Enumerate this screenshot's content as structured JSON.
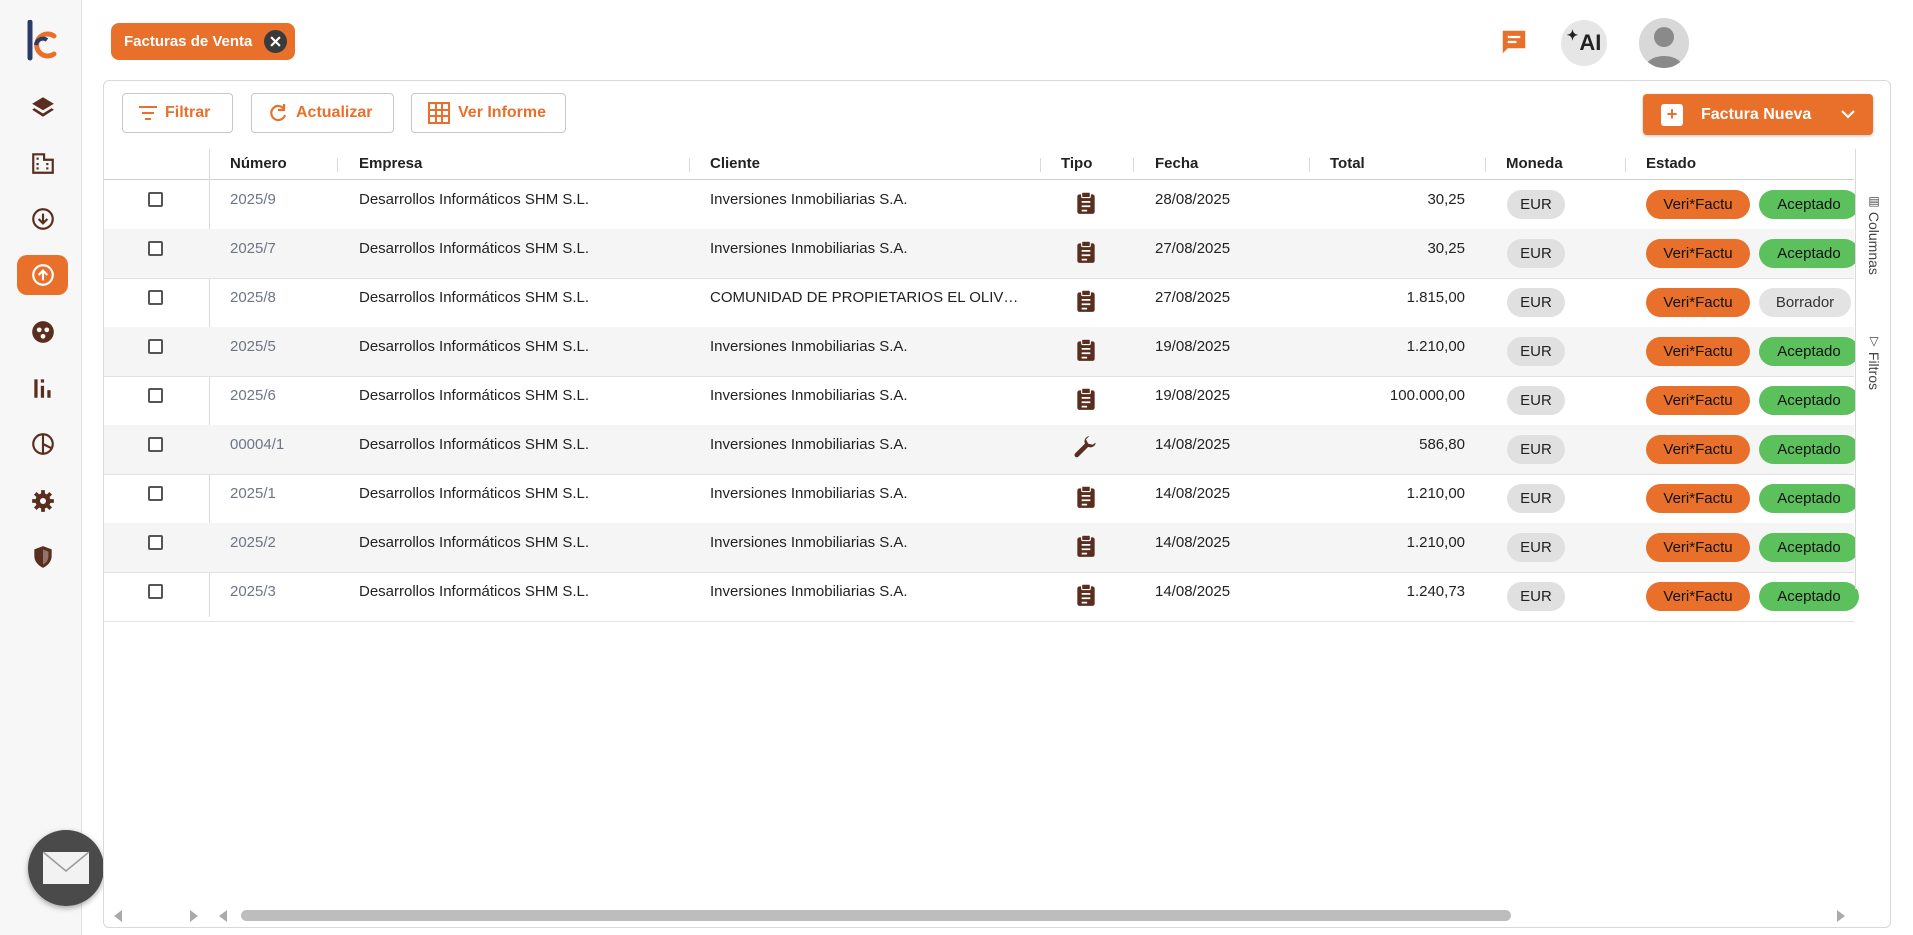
{
  "tabs": {
    "active_label": "Facturas de Venta"
  },
  "header": {
    "ai_label": "AI"
  },
  "toolbar": {
    "filter": "Filtrar",
    "refresh": "Actualizar",
    "report": "Ver Informe",
    "new_invoice": "Factura Nueva"
  },
  "columns": {
    "numero": "Número",
    "empresa": "Empresa",
    "cliente": "Cliente",
    "tipo": "Tipo",
    "fecha": "Fecha",
    "total": "Total",
    "moneda": "Moneda",
    "estado": "Estado"
  },
  "side_tabs": {
    "columns": "Columnas",
    "filters": "Filtros"
  },
  "colors": {
    "accent": "#e8702a",
    "accepted": "#5cc05c",
    "draft": "#e3e3e3"
  },
  "rows": [
    {
      "numero": "2025/9",
      "empresa": "Desarrollos Informáticos SHM S.L.",
      "cliente": "Inversiones Inmobiliarias S.A.",
      "tipo": "clipboard-icon",
      "fecha": "28/08/2025",
      "total": "30,25",
      "moneda": "EUR",
      "veri": "Veri*Factu",
      "estado": "Aceptado"
    },
    {
      "numero": "2025/7",
      "empresa": "Desarrollos Informáticos SHM S.L.",
      "cliente": "Inversiones Inmobiliarias S.A.",
      "tipo": "clipboard-icon",
      "fecha": "27/08/2025",
      "total": "30,25",
      "moneda": "EUR",
      "veri": "Veri*Factu",
      "estado": "Aceptado"
    },
    {
      "numero": "2025/8",
      "empresa": "Desarrollos Informáticos SHM S.L.",
      "cliente": "COMUNIDAD DE PROPIETARIOS EL OLIV…",
      "tipo": "clipboard-icon",
      "fecha": "27/08/2025",
      "total": "1.815,00",
      "moneda": "EUR",
      "veri": "Veri*Factu",
      "estado": "Borrador"
    },
    {
      "numero": "2025/5",
      "empresa": "Desarrollos Informáticos SHM S.L.",
      "cliente": "Inversiones Inmobiliarias S.A.",
      "tipo": "clipboard-icon",
      "fecha": "19/08/2025",
      "total": "1.210,00",
      "moneda": "EUR",
      "veri": "Veri*Factu",
      "estado": "Aceptado"
    },
    {
      "numero": "2025/6",
      "empresa": "Desarrollos Informáticos SHM S.L.",
      "cliente": "Inversiones Inmobiliarias S.A.",
      "tipo": "clipboard-icon",
      "fecha": "19/08/2025",
      "total": "100.000,00",
      "moneda": "EUR",
      "veri": "Veri*Factu",
      "estado": "Aceptado"
    },
    {
      "numero": "00004/1",
      "empresa": "Desarrollos Informáticos SHM S.L.",
      "cliente": "Inversiones Inmobiliarias S.A.",
      "tipo": "wrench-icon",
      "fecha": "14/08/2025",
      "total": "586,80",
      "moneda": "EUR",
      "veri": "Veri*Factu",
      "estado": "Aceptado"
    },
    {
      "numero": "2025/1",
      "empresa": "Desarrollos Informáticos SHM S.L.",
      "cliente": "Inversiones Inmobiliarias S.A.",
      "tipo": "clipboard-icon",
      "fecha": "14/08/2025",
      "total": "1.210,00",
      "moneda": "EUR",
      "veri": "Veri*Factu",
      "estado": "Aceptado"
    },
    {
      "numero": "2025/2",
      "empresa": "Desarrollos Informáticos SHM S.L.",
      "cliente": "Inversiones Inmobiliarias S.A.",
      "tipo": "clipboard-icon",
      "fecha": "14/08/2025",
      "total": "1.210,00",
      "moneda": "EUR",
      "veri": "Veri*Factu",
      "estado": "Aceptado"
    },
    {
      "numero": "2025/3",
      "empresa": "Desarrollos Informáticos SHM S.L.",
      "cliente": "Inversiones Inmobiliarias S.A.",
      "tipo": "clipboard-icon",
      "fecha": "14/08/2025",
      "total": "1.240,73",
      "moneda": "EUR",
      "veri": "Veri*Factu",
      "estado": "Aceptado"
    }
  ],
  "sidebar": {
    "items": [
      {
        "icon": "layers-icon"
      },
      {
        "icon": "building-icon"
      },
      {
        "icon": "download-circle-icon"
      },
      {
        "icon": "upload-circle-icon",
        "active": true
      },
      {
        "icon": "people-icon"
      },
      {
        "icon": "bar-chart-icon"
      },
      {
        "icon": "pie-chart-icon"
      },
      {
        "icon": "gear-icon"
      },
      {
        "icon": "shield-icon"
      }
    ]
  }
}
